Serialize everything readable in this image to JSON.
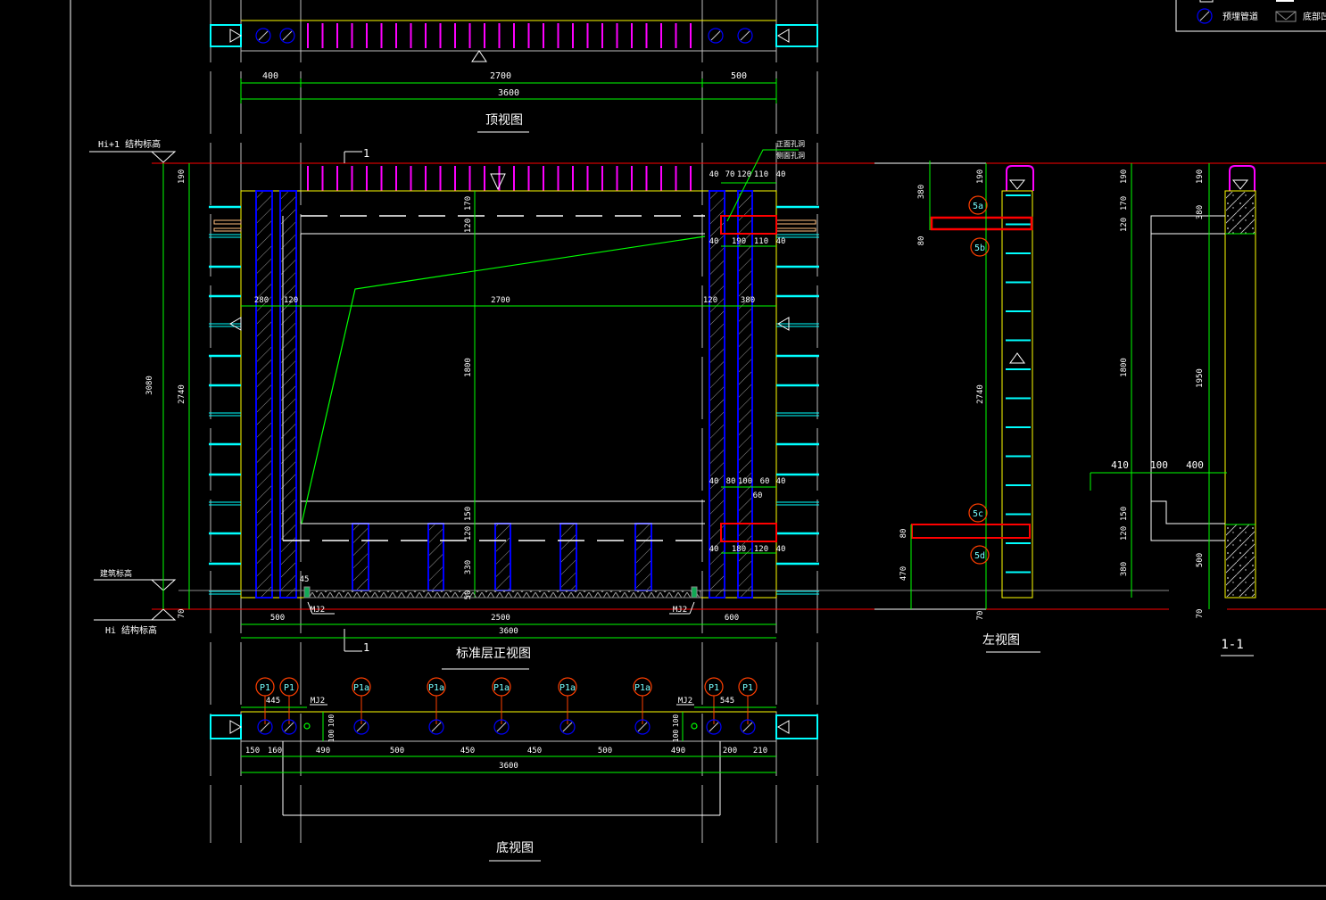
{
  "views": {
    "top_title": "顶视图",
    "front_title": "标准层正视图",
    "left_title": "左视图",
    "section_title": "1-1",
    "bottom_title": "底视图"
  },
  "levels": {
    "upper": "Hi+1 结构标高",
    "finish": "建筑标高",
    "lower": "Hi 结构标高"
  },
  "section_mark": "1",
  "legend": {
    "items": [
      {
        "label": "预埋管道",
        "icon": "embedded-pipe-icon"
      },
      {
        "label": "底部凹槽",
        "icon": "bottom-groove-icon"
      }
    ]
  },
  "callouts": {
    "hole_labels": [
      "正面孔洞",
      "侧面孔洞"
    ],
    "mj2": "MJ2"
  },
  "top_dims": [
    "400",
    "2700",
    "500",
    "3600"
  ],
  "front_dims": {
    "upper_right_a": [
      "40",
      "70",
      "120",
      "110",
      "40"
    ],
    "upper_right_b": [
      "40",
      "190",
      "110",
      "40"
    ],
    "middle": [
      "280",
      "120",
      "2700",
      "120",
      "380"
    ],
    "lower_right_a": [
      "40",
      "80",
      "100",
      "60",
      "40",
      "60"
    ],
    "lower_right_b": [
      "40",
      "180",
      "120",
      "40"
    ],
    "bottom": [
      "45",
      "500",
      "2500",
      "600",
      "3600"
    ],
    "left_vertical": [
      "190",
      "3080",
      "2740",
      "70"
    ],
    "center_vertical": [
      "170",
      "120",
      "1800",
      "150",
      "120",
      "330",
      "50"
    ]
  },
  "left_view": {
    "dims": [
      "380",
      "80",
      "190",
      "2740",
      "80",
      "470",
      "70"
    ],
    "tags": [
      "5a",
      "5b",
      "5c",
      "5d"
    ]
  },
  "section_view": {
    "dims": [
      "190",
      "170",
      "120",
      "1800",
      "150",
      "120",
      "380",
      "190",
      "380",
      "1950",
      "500",
      "70",
      "410",
      "100",
      "400"
    ]
  },
  "bottom_view": {
    "tags": [
      "P1",
      "P1",
      "P1a",
      "P1a",
      "P1a",
      "P1a",
      "P1a",
      "P1",
      "P1"
    ],
    "side_dims": [
      "445",
      "545",
      "100",
      "100",
      "100",
      "100"
    ],
    "dims": [
      "150",
      "160",
      "490",
      "500",
      "450",
      "450",
      "500",
      "490",
      "200",
      "210",
      "3600"
    ]
  },
  "colors": {
    "dimension": "#00ff00",
    "level_line": "#ff0000",
    "outline": "#ffff00",
    "column": "#0000ff",
    "rebar": "#ff00ff",
    "tab": "#00ffff",
    "tag": "#ff3f00"
  }
}
